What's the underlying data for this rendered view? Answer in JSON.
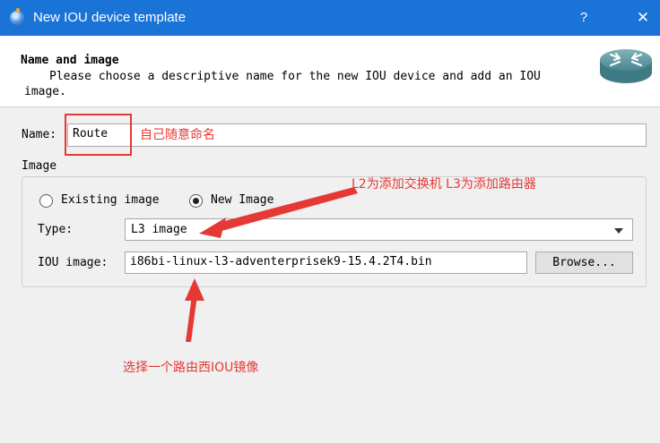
{
  "window": {
    "title": "New IOU device template",
    "help_glyph": "?",
    "close_glyph": "✕"
  },
  "header": {
    "title": "Name and image",
    "subtitle": "Please choose a descriptive name for the new IOU device and add an IOU image.",
    "logo_icon": "router-icon"
  },
  "form": {
    "name_label": "Name:",
    "name_value": "Route",
    "image_group_label": "Image",
    "existing_image_label": "Existing image",
    "new_image_label": "New Image",
    "selected_option": "new_image",
    "type_label": "Type:",
    "type_value": "L3 image",
    "iou_image_label": "IOU image:",
    "iou_image_value": "i86bi-linux-l3-adventerprisek9-15.4.2T4.bin",
    "browse_label": "Browse..."
  },
  "annotations": {
    "name_note": "自己随意命名",
    "type_note": "L2为添加交换机 L3为添加路由器",
    "image_note": "选择一个路由西IOU镜像",
    "color": "#e53935"
  },
  "colors": {
    "titlebar": "#1a73d6",
    "background": "#f0f0f0"
  }
}
